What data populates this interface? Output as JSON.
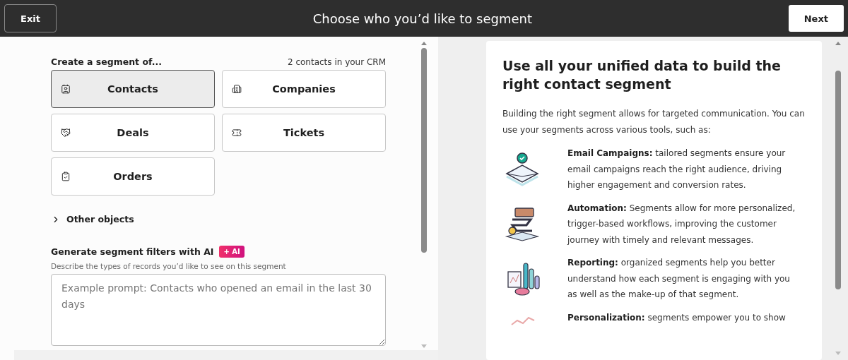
{
  "header": {
    "exit_label": "Exit",
    "title": "Choose who you’d like to segment",
    "next_label": "Next"
  },
  "objects": {
    "heading": "Create a segment of...",
    "count": "2 contacts in your CRM",
    "items": [
      {
        "kind": "contacts",
        "label": "Contacts",
        "selected": true
      },
      {
        "kind": "companies",
        "label": "Companies",
        "selected": false
      },
      {
        "kind": "deals",
        "label": "Deals",
        "selected": false
      },
      {
        "kind": "tickets",
        "label": "Tickets",
        "selected": false
      },
      {
        "kind": "orders",
        "label": "Orders",
        "selected": false
      }
    ],
    "other": {
      "label": "Other objects",
      "expanded": false
    }
  },
  "ai": {
    "heading": "Generate segment filters with AI",
    "badge": "+ AI",
    "hint": "Describe the types of records you’d like to see on this segment",
    "placeholder": "Example prompt: Contacts who opened an email in the last 30 days"
  },
  "info": {
    "heading": "Use all your unified data to build the right contact segment",
    "intro": "Building the right segment allows for targeted communication. You can use your segments across various tools, such as:",
    "features": [
      {
        "kind": "email",
        "text": "**Email Campaigns:** tailored segments ensure your email campaigns reach the right audience, driving higher engagement and conversion rates."
      },
      {
        "kind": "automation",
        "text": "**Automation:** Segments allow for more personalized, trigger-based workflows, improving the customer journey with timely and relevant messages."
      },
      {
        "kind": "reporting",
        "text": "**Reporting:** organized segments help you better understand how each segment is engaging with you as well as the make-up of that segment."
      },
      {
        "kind": "personalization",
        "text": "**Personalization:** segments empower you to show"
      }
    ]
  }
}
